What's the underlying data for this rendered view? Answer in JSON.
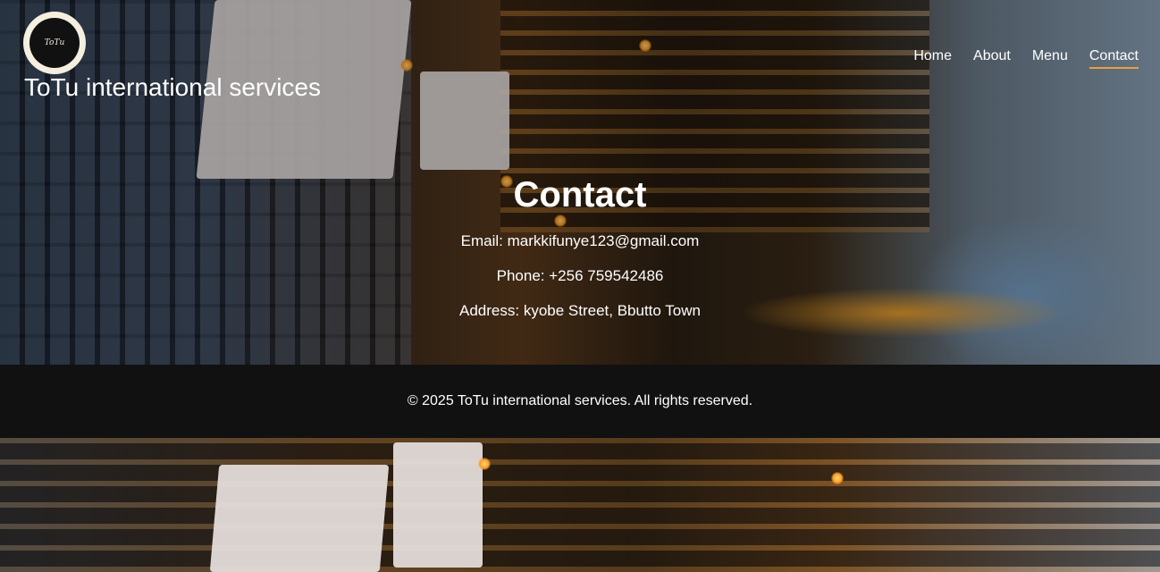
{
  "header": {
    "logo_text": "ToTu",
    "site_name": "ToTu international services"
  },
  "nav": {
    "items": [
      {
        "label": "Home"
      },
      {
        "label": "About"
      },
      {
        "label": "Menu"
      },
      {
        "label": "Contact"
      }
    ],
    "active": "Contact"
  },
  "contact": {
    "title": "Contact",
    "email": "Email: markkifunye123@gmail.com",
    "phone": "Phone: +256 759542486",
    "address": "Address: kyobe Street, Bbutto Town"
  },
  "footer": {
    "text": "© 2025 ToTu international services. All rights reserved."
  },
  "colors": {
    "nav_active_underline": "#e8a23a",
    "footer_bg": "#111111",
    "text": "#ffffff"
  }
}
